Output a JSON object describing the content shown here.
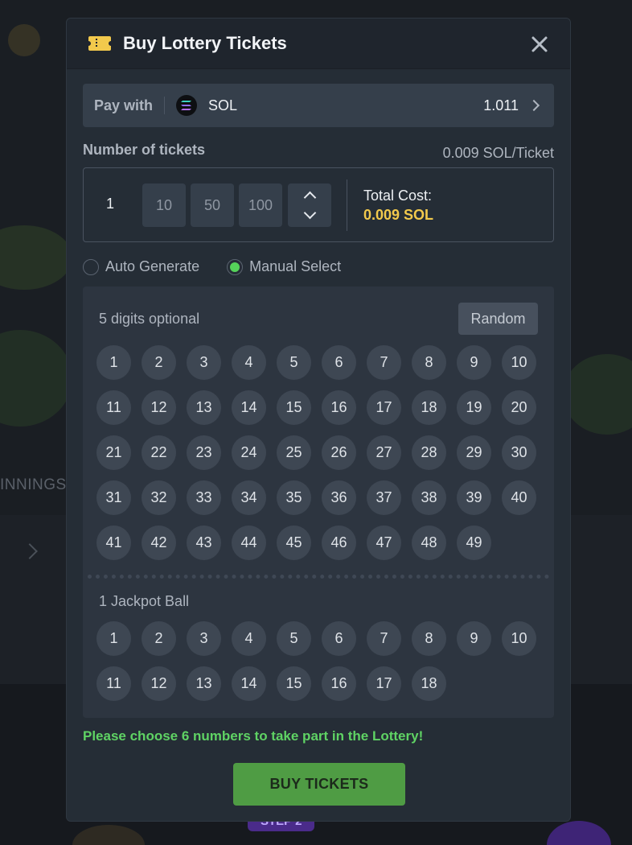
{
  "modal": {
    "title": "Buy Lottery Tickets"
  },
  "pay": {
    "label": "Pay with",
    "currency": "SOL",
    "balance": "1.011"
  },
  "tickets": {
    "label": "Number of tickets",
    "price_per": "0.009 SOL/Ticket",
    "quantity": "1",
    "presets": [
      "10",
      "50",
      "100"
    ],
    "total_label": "Total Cost:",
    "total_value": "0.009 SOL"
  },
  "mode": {
    "options": [
      {
        "label": "Auto Generate",
        "checked": false
      },
      {
        "label": "Manual Select",
        "checked": true
      }
    ]
  },
  "picker": {
    "main_title": "5 digits optional",
    "random_label": "Random",
    "main_numbers": [
      "1",
      "2",
      "3",
      "4",
      "5",
      "6",
      "7",
      "8",
      "9",
      "10",
      "11",
      "12",
      "13",
      "14",
      "15",
      "16",
      "17",
      "18",
      "19",
      "20",
      "21",
      "22",
      "23",
      "24",
      "25",
      "26",
      "27",
      "28",
      "29",
      "30",
      "31",
      "32",
      "33",
      "34",
      "35",
      "36",
      "37",
      "38",
      "39",
      "40",
      "41",
      "42",
      "43",
      "44",
      "45",
      "46",
      "47",
      "48",
      "49"
    ],
    "jackpot_title": "1 Jackpot Ball",
    "jackpot_numbers": [
      "1",
      "2",
      "3",
      "4",
      "5",
      "6",
      "7",
      "8",
      "9",
      "10",
      "11",
      "12",
      "13",
      "14",
      "15",
      "16",
      "17",
      "18"
    ]
  },
  "warning": "Please choose 6 numbers to take part in the Lottery!",
  "buy_label": "BUY TICKETS",
  "background": {
    "winnings_fragment": "INNINGS",
    "step_badge": "STEP 2"
  },
  "colors": {
    "accent_green": "#55d35a",
    "total_gold": "#f2c94c",
    "buy_button": "#4f9c44"
  }
}
